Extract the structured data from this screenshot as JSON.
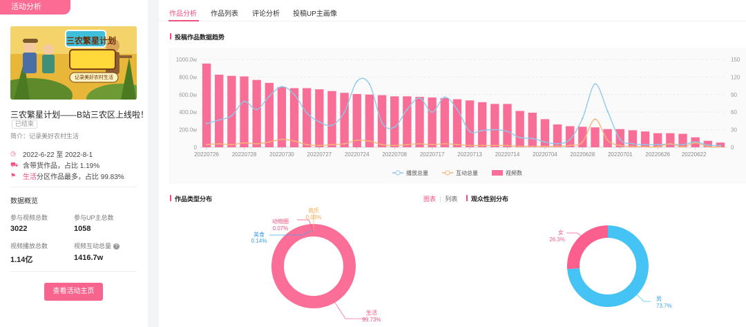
{
  "left": {
    "badge": "活动分析",
    "cover_text": "三农繁星计划",
    "cover_sub": "记录美好农村生活",
    "title": "三农繁星计划——B站三农区上线啦！",
    "status": "已结束",
    "intro": "简介：记录美好农村生活",
    "date_range": "2022-6-22 至 2022-8-1",
    "goods": "含带货作品，占比 1.19%",
    "category_name": "生活",
    "category_text": " 分区作品最多，占比 99.83%",
    "section_title": "数据概览",
    "stats": [
      {
        "label": "参与视频总数",
        "value": "3022"
      },
      {
        "label": "参与UP主总数",
        "value": "1058"
      },
      {
        "label": "视频播放总数",
        "value": "1.14亿"
      },
      {
        "label": "视频互动总量",
        "value": "1416.7w"
      }
    ],
    "button": "查看活动主页"
  },
  "tabs": [
    {
      "label": "作品分析",
      "active": true
    },
    {
      "label": "作品列表",
      "active": false
    },
    {
      "label": "评论分析",
      "active": false
    },
    {
      "label": "投稿UP主画像",
      "active": false
    }
  ],
  "sections": {
    "trend": "投稿作品数据趋势",
    "type": "作品类型分布",
    "gender": "观众性别分布"
  },
  "toggle": {
    "chart": "图表",
    "list": "列表"
  },
  "colors": {
    "accent": "#f0507e",
    "bar": "#f96e96",
    "play": "#8ec9ea",
    "interact": "#f5b57a",
    "male": "#46c3f5",
    "female": "#fb5f8d"
  },
  "chart_data": [
    {
      "type": "bar",
      "x_tick_labels": [
        "20220726",
        "20220728",
        "20220730",
        "20220727",
        "20220724",
        "20220708",
        "20220717",
        "20220713",
        "20220714",
        "20220704",
        "20220628",
        "20220701",
        "20220626",
        "20220622"
      ],
      "y_left_ticks": [
        "1000.0w",
        "800.0w",
        "600.0w",
        "400.0w",
        "200.0w",
        "0"
      ],
      "y_right_ticks": [
        "150",
        "120",
        "90",
        "60",
        "30",
        "0"
      ],
      "ylim_left": [
        0,
        1000
      ],
      "ylim_right": [
        0,
        150
      ],
      "legend": [
        "播放总量",
        "互动总量",
        "视频数"
      ],
      "series": [
        {
          "name": "视频数",
          "axis": "right",
          "values": [
            143,
            124,
            122,
            121,
            115,
            110,
            103,
            101,
            101,
            99,
            96,
            93,
            91,
            90,
            89,
            87,
            87,
            86,
            85,
            84,
            82,
            80,
            77,
            74,
            74,
            62,
            59,
            48,
            39,
            36,
            35,
            34,
            31,
            31,
            29,
            27,
            24,
            24,
            23,
            17,
            11,
            8
          ]
        },
        {
          "name": "播放总量",
          "axis": "left",
          "values": [
            270,
            310,
            360,
            520,
            430,
            580,
            690,
            600,
            390,
            290,
            250,
            400,
            750,
            720,
            280,
            230,
            430,
            560,
            400,
            570,
            430,
            180,
            190,
            200,
            180,
            110,
            100,
            60,
            40,
            90,
            330,
            720,
            410,
            90,
            40,
            30,
            30,
            35,
            30,
            60,
            25,
            20
          ]
        },
        {
          "name": "互动总量",
          "axis": "left",
          "values": [
            30,
            40,
            30,
            50,
            40,
            60,
            90,
            70,
            30,
            20,
            30,
            40,
            80,
            70,
            30,
            20,
            30,
            40,
            30,
            40,
            30,
            20,
            20,
            20,
            20,
            10,
            10,
            10,
            10,
            20,
            60,
            320,
            80,
            20,
            10,
            5,
            5,
            40,
            5,
            50,
            5,
            5
          ]
        }
      ]
    },
    {
      "type": "pie",
      "labels": [
        "生活",
        "美食",
        "动物圈",
        "音乐"
      ],
      "percents": [
        "99.73%",
        "0.14%",
        "0.07%",
        "0.03%"
      ],
      "values": [
        99.73,
        0.14,
        0.07,
        0.03
      ]
    },
    {
      "type": "pie",
      "labels": [
        "男",
        "女"
      ],
      "percents": [
        "73.7%",
        "26.3%"
      ],
      "values": [
        73.7,
        26.3
      ]
    }
  ]
}
